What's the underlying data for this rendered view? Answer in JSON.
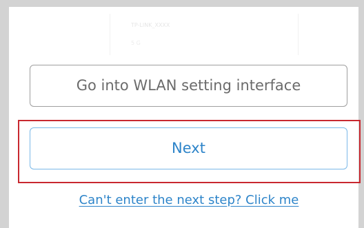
{
  "background_preview": {
    "ssid_text": "TP-LINK_XXXX",
    "sub_text": "5 G"
  },
  "buttons": {
    "wlan_label": "Go into WLAN setting interface",
    "next_label": "Next"
  },
  "help_link": {
    "label": "Can't enter the next step? Click me"
  },
  "colors": {
    "accent": "#2d84c9",
    "next_border": "#7ab8e8",
    "highlight": "#c8282f",
    "secondary_border": "#9e9e9e",
    "secondary_text": "#6b6b6b"
  }
}
